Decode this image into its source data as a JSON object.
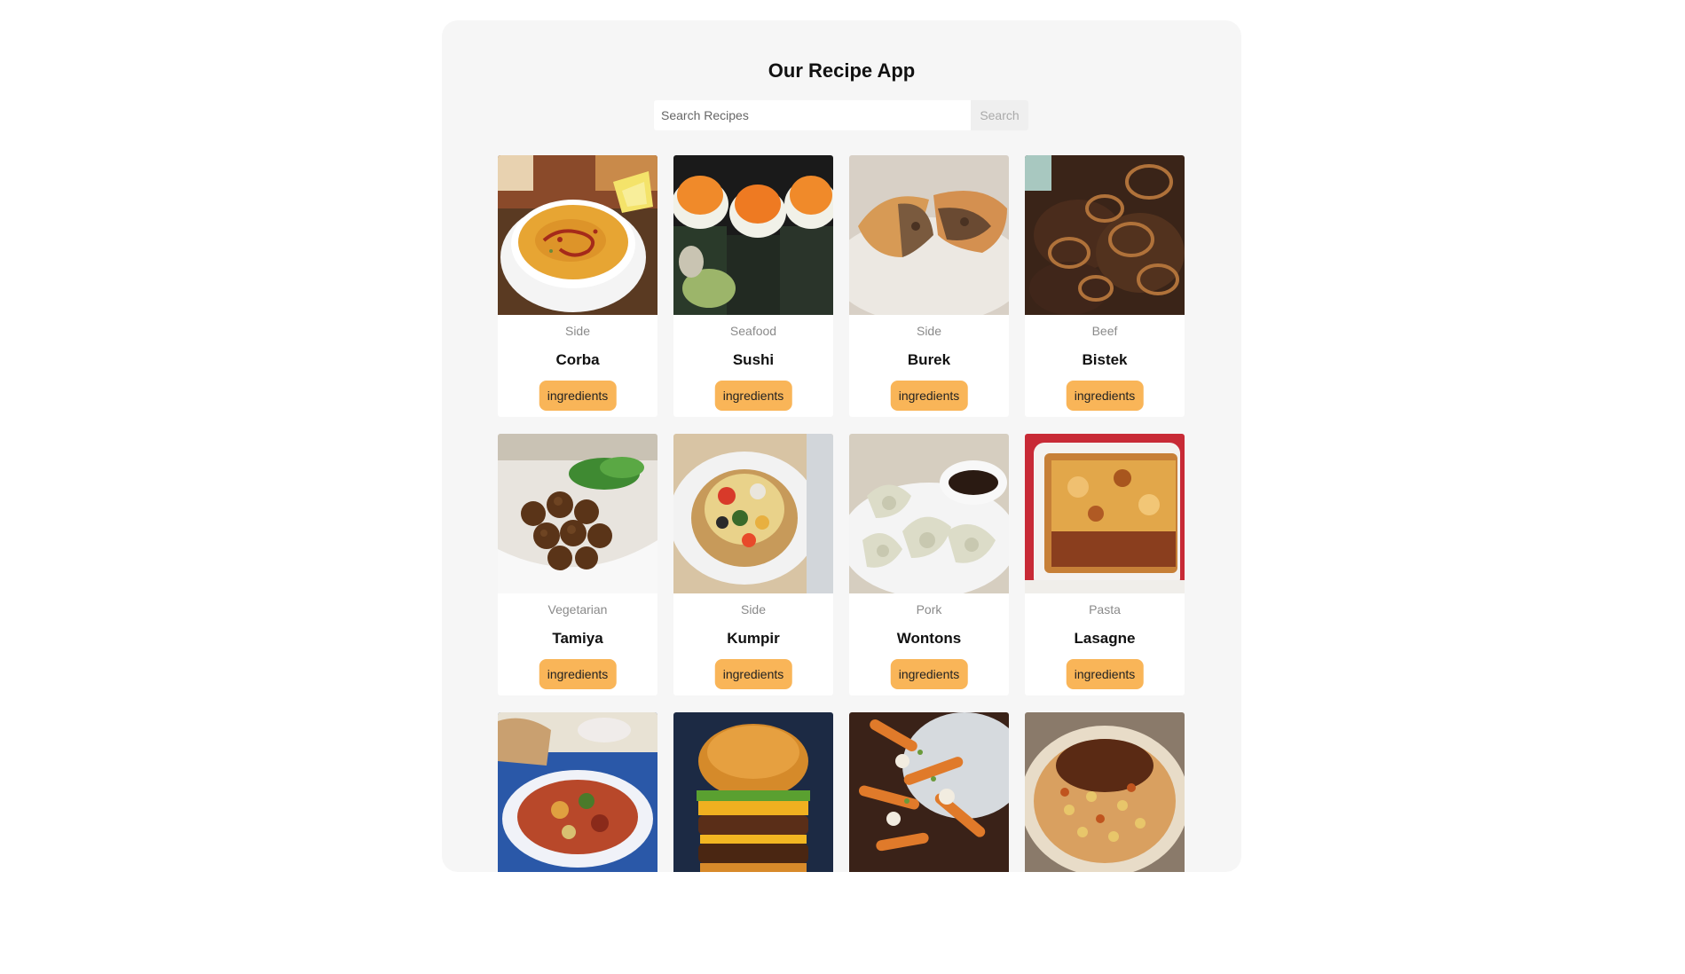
{
  "app": {
    "title": "Our Recipe App"
  },
  "search": {
    "placeholder": "Search Recipes",
    "value": "",
    "button_label": "Search"
  },
  "colors": {
    "accent": "#f9b558",
    "panel": "#f6f6f6"
  },
  "meals": [
    {
      "category": "Side",
      "name": "Corba",
      "button": "ingredients",
      "image": "corba-soup"
    },
    {
      "category": "Seafood",
      "name": "Sushi",
      "button": "ingredients",
      "image": "sushi"
    },
    {
      "category": "Side",
      "name": "Burek",
      "button": "ingredients",
      "image": "burek"
    },
    {
      "category": "Beef",
      "name": "Bistek",
      "button": "ingredients",
      "image": "bistek"
    },
    {
      "category": "Vegetarian",
      "name": "Tamiya",
      "button": "ingredients",
      "image": "tamiya"
    },
    {
      "category": "Side",
      "name": "Kumpir",
      "button": "ingredients",
      "image": "kumpir"
    },
    {
      "category": "Pork",
      "name": "Wontons",
      "button": "ingredients",
      "image": "wontons"
    },
    {
      "category": "Pasta",
      "name": "Lasagne",
      "button": "ingredients",
      "image": "lasagne"
    },
    {
      "category": "",
      "name": "",
      "button": "",
      "image": "tagine"
    },
    {
      "category": "",
      "name": "",
      "button": "",
      "image": "burger"
    },
    {
      "category": "",
      "name": "",
      "button": "",
      "image": "poutine"
    },
    {
      "category": "",
      "name": "",
      "button": "",
      "image": "koshari"
    }
  ]
}
